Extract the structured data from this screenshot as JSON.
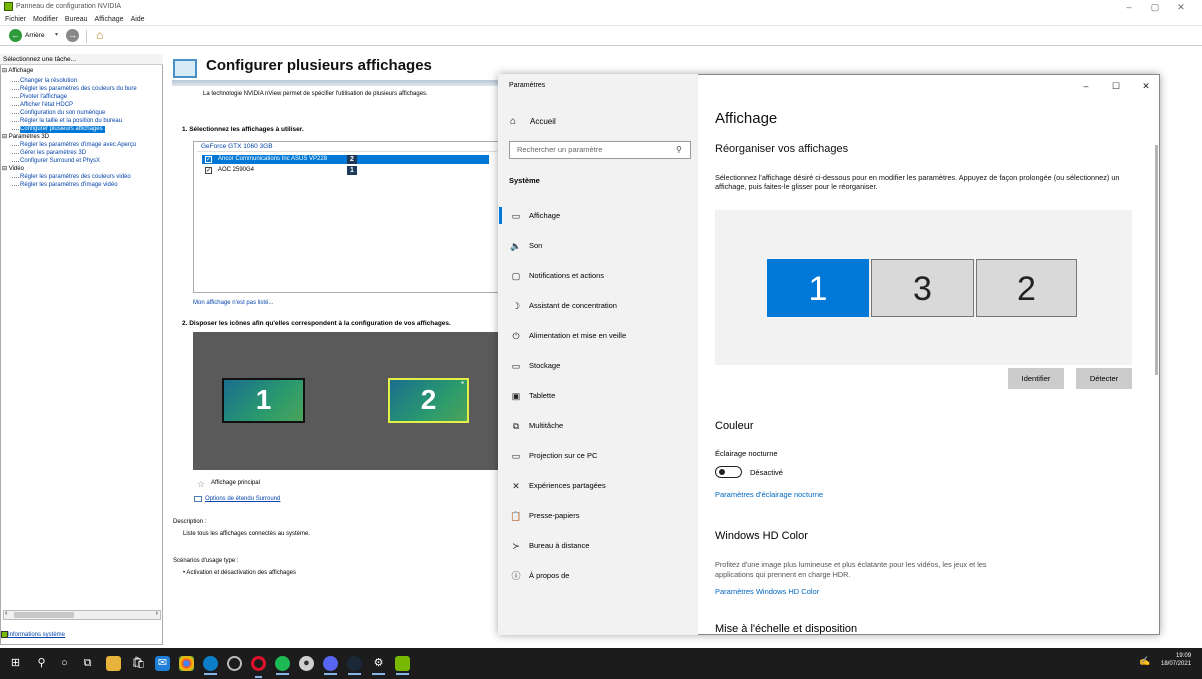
{
  "nvidia": {
    "title": "Panneau de configuration NVIDIA",
    "menu": [
      "Fichier",
      "Modifier",
      "Bureau",
      "Affichage",
      "Aide"
    ],
    "back_label": "Arrière",
    "sidebar_header": "Sélectionnez une tâche...",
    "tree": {
      "affichage": "Affichage",
      "affichage_items": [
        "Changer la résolution",
        "Régler les paramètres des couleurs du bure",
        "Pivoter l'affichage",
        "Afficher l'état HDCP",
        "Configuration du son numérique",
        "Régler la taille et la position du bureau",
        "Configurer plusieurs affichages"
      ],
      "p3d": "Paramètres 3D",
      "p3d_items": [
        "Régler les paramètres d'image avec Aperçu",
        "Gérer les paramètres 3D",
        "Configurer Surround et PhysX"
      ],
      "video": "Vidéo",
      "video_items": [
        "Régler les paramètres des couleurs vidéo",
        "Régler les paramètres d'image vidéo"
      ]
    },
    "sysinfo": "Informations système",
    "page_title": "Configurer plusieurs affichages",
    "page_desc": "La technologie NVIDIA nView permet de spécifier l'utilisation de plusieurs affichages.",
    "section1": "1. Sélectionnez les affichages à utiliser.",
    "gpu": "GeForce GTX 1060 3GB",
    "displays": [
      {
        "name": "Ancor Communications Inc ASUS VP228",
        "badge": "2"
      },
      {
        "name": "AOC 2590G4",
        "badge": "1"
      }
    ],
    "not_listed": "Mon affichage n'est pas listé...",
    "section2": "2. Disposer les icônes afin qu'elles correspondent à la configuration de vos affichages.",
    "monitors": [
      "1",
      "2"
    ],
    "star": "*",
    "primary": "Affichage principal",
    "surround": "Options de étendu Surround",
    "desc_h": "Description :",
    "desc_t": "Liste tous les affichages connectés au système.",
    "scen_h": "Scénarios d'usage type :",
    "scen_t": "• Activation et désactivation des affichages"
  },
  "settings": {
    "title": "Paramètres",
    "home": "Accueil",
    "search_placeholder": "Rechercher un paramètre",
    "section": "Système",
    "nav": [
      {
        "icon": "monitor-icon",
        "label": "Affichage"
      },
      {
        "icon": "speaker-icon",
        "label": "Son"
      },
      {
        "icon": "notification-icon",
        "label": "Notifications et actions"
      },
      {
        "icon": "moon-icon",
        "label": "Assistant de concentration"
      },
      {
        "icon": "power-icon",
        "label": "Alimentation et mise en veille"
      },
      {
        "icon": "storage-icon",
        "label": "Stockage"
      },
      {
        "icon": "tablet-icon",
        "label": "Tablette"
      },
      {
        "icon": "multitask-icon",
        "label": "Multitâche"
      },
      {
        "icon": "projector-icon",
        "label": "Projection sur ce PC"
      },
      {
        "icon": "shared-icon",
        "label": "Expériences partagées"
      },
      {
        "icon": "clipboard-icon",
        "label": "Presse-papiers"
      },
      {
        "icon": "remote-icon",
        "label": "Bureau à distance"
      },
      {
        "icon": "info-icon",
        "label": "À propos de"
      }
    ],
    "heading": "Affichage",
    "subheading": "Réorganiser vos affichages",
    "instructions": "Sélectionnez l'affichage désiré ci-dessous pour en modifier les paramètres. Appuyez de façon prolongée (ou sélectionnez) un affichage, puis faites-le glisser pour le réorganiser.",
    "monitors": [
      "1",
      "3",
      "2"
    ],
    "identify": "Identifier",
    "detect": "Détecter",
    "color_h": "Couleur",
    "night_label": "Éclairage nocturne",
    "night_state": "Désactivé",
    "night_link": "Paramètres d'éclairage nocturne",
    "hd_h": "Windows HD Color",
    "hd_p": "Profitez d'une image plus lumineuse et plus éclatante pour les vidéos, les jeux et les applications qui prennent en charge HDR.",
    "hd_link": "Paramètres Windows HD Color",
    "scale_h": "Mise à l'échelle et disposition"
  },
  "taskbar": {
    "time": "19:09",
    "date": "18/07/2021"
  },
  "colors": {
    "accent": "#0078d7",
    "nvidia_green": "#76b900",
    "link": "#0067c0"
  }
}
